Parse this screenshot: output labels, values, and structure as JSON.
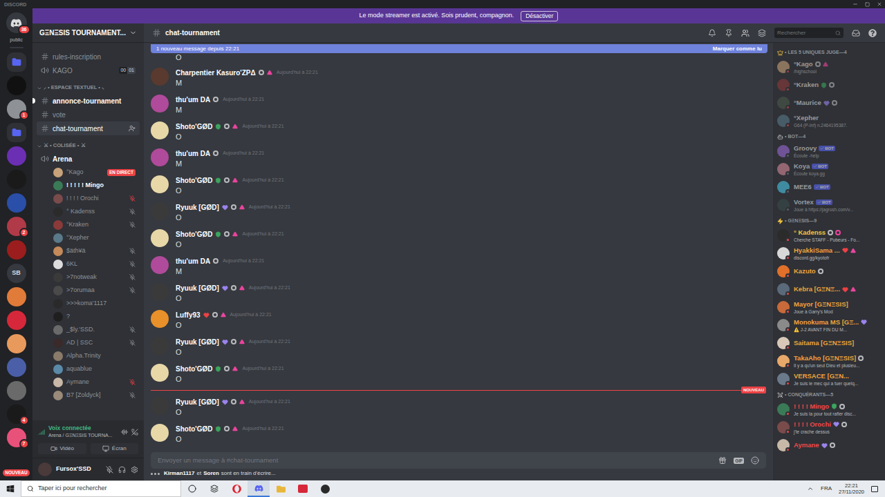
{
  "window": {
    "title": "DISCORD"
  },
  "streamer_banner": {
    "text": "Le mode streamer est activé. Sois prudent, compagnon.",
    "button": "Désactiver"
  },
  "server_rail": {
    "home_badge": "36",
    "home_label": "public",
    "new_label": "NOUVEAU",
    "servers": [
      {
        "kind": "folder",
        "color": "#5865f2"
      },
      {
        "kind": "server",
        "color": "#111111"
      },
      {
        "kind": "server",
        "color": "#8e9297",
        "badge": "1"
      },
      {
        "kind": "folder",
        "color": "#5865f2"
      },
      {
        "kind": "server",
        "color": "#6b2fb3"
      },
      {
        "kind": "server",
        "color": "#1a1a1a"
      },
      {
        "kind": "server",
        "color": "#2a4fa8"
      },
      {
        "kind": "server",
        "color": "#b03a48",
        "badge": "2"
      },
      {
        "kind": "server",
        "color": "#9c1d1d"
      },
      {
        "kind": "text",
        "color": "#36393f",
        "label": "SB"
      },
      {
        "kind": "server",
        "color": "#e07b39"
      },
      {
        "kind": "server",
        "color": "#d6283a"
      },
      {
        "kind": "server",
        "color": "#e89a5c"
      },
      {
        "kind": "server",
        "color": "#4a5fa8"
      },
      {
        "kind": "server",
        "color": "#6a6a6a"
      },
      {
        "kind": "server",
        "color": "#1a1a1a",
        "badge": "4"
      },
      {
        "kind": "server",
        "color": "#e8517a",
        "badge": "7"
      }
    ]
  },
  "server": {
    "name": "GΞNΞSIS TOURNAMENT..."
  },
  "channels": [
    {
      "kind": "text",
      "name": "rules-inscription",
      "unread": false,
      "selected": false
    },
    {
      "kind": "voice",
      "name": "KAGO",
      "connected": false,
      "counts": [
        "00",
        "01"
      ]
    },
    {
      "kind": "category",
      "name": "⸝ • ESPACE TEXTUEL • ⸜"
    },
    {
      "kind": "text",
      "name": "annonce-tournament",
      "unread": true,
      "selected": false
    },
    {
      "kind": "text",
      "name": "vote",
      "unread": false,
      "selected": false
    },
    {
      "kind": "text",
      "name": "chat-tournament",
      "unread": false,
      "selected": true
    },
    {
      "kind": "category",
      "name": "⚔ • COLISÉE • ⚔"
    },
    {
      "kind": "voice",
      "name": "Arena",
      "connected": true,
      "counts": []
    }
  ],
  "voice_users": [
    {
      "name": "°Kago",
      "avatar": "#c8a27a",
      "muted": false,
      "server_muted": false,
      "highlighted": false,
      "live": "EN DIRECT"
    },
    {
      "name": "! ! ! ! ! Mingo",
      "avatar": "#3b7a57",
      "muted": false,
      "server_muted": false,
      "highlighted": true
    },
    {
      "name": "! ! ! ! Orochi",
      "avatar": "#7a4b4b",
      "muted": true,
      "server_muted": true,
      "highlighted": false
    },
    {
      "name": "° Kadenss",
      "avatar": "#2b2b2b",
      "muted": true,
      "server_muted": false,
      "highlighted": false
    },
    {
      "name": "°Kraken",
      "avatar": "#8b3a3a",
      "muted": true,
      "server_muted": false,
      "highlighted": false
    },
    {
      "name": "°Xepher",
      "avatar": "#5a7a8a",
      "muted": false,
      "server_muted": false,
      "highlighted": false
    },
    {
      "name": "$äth¥ä",
      "avatar": "#c48a5a",
      "muted": true,
      "server_muted": false,
      "highlighted": false
    },
    {
      "name": "6KL",
      "avatar": "#dcdcdc",
      "muted": true,
      "server_muted": false,
      "highlighted": false
    },
    {
      "name": ">7notweak",
      "avatar": "#3a3a3a",
      "muted": true,
      "server_muted": false,
      "highlighted": false
    },
    {
      "name": ">7orumaa",
      "avatar": "#4a4a4a",
      "muted": true,
      "server_muted": false,
      "highlighted": false
    },
    {
      "name": ">>>koma'1117",
      "avatar": "#2a2a2a",
      "muted": false,
      "server_muted": false,
      "highlighted": false
    },
    {
      "name": "?",
      "avatar": "#1f1f1f",
      "muted": false,
      "server_muted": false,
      "highlighted": false
    },
    {
      "name": "_$ly.'SSD.",
      "avatar": "#6a6a6a",
      "muted": true,
      "server_muted": false,
      "highlighted": false
    },
    {
      "name": "AD | SSC",
      "avatar": "#3a2a2a",
      "muted": true,
      "server_muted": false,
      "highlighted": false
    },
    {
      "name": "Alpha.Trinity",
      "avatar": "#8a7a6a",
      "muted": false,
      "server_muted": false,
      "highlighted": false
    },
    {
      "name": "aquablue",
      "avatar": "#5a8aa8",
      "muted": false,
      "server_muted": false,
      "highlighted": false
    },
    {
      "name": "Aymane",
      "avatar": "#c8b8a8",
      "muted": true,
      "server_muted": true,
      "highlighted": false
    },
    {
      "name": "B7 [Zoldyck]",
      "avatar": "#9a8a7a",
      "muted": true,
      "server_muted": false,
      "highlighted": false
    }
  ],
  "voice_panel": {
    "title": "Voix connectée",
    "subtitle": "Arena / GΞNΞSIS TOURNA...",
    "buttons": [
      "Vidéo",
      "Écran"
    ]
  },
  "user": {
    "name": "Fursox'SSD",
    "avatar": "#4a3a3a",
    "mic_muted": true
  },
  "header": {
    "channel": "chat-tournament",
    "search_placeholder": "Rechercher"
  },
  "new_messages_bar": {
    "text": "1 nouveau message depuis 22:21",
    "action": "Marquer comme lu"
  },
  "new_divider": {
    "label": "NOUVEAU"
  },
  "messages": [
    {
      "kind": "partial",
      "content": "O"
    },
    {
      "kind": "full",
      "author": "Charpentier Kasuro'ZPΔ",
      "avatar": "#5a3a2e",
      "time": "Aujourd'hui à 22:21",
      "content": "M",
      "divider_before": false,
      "badges": [
        {
          "kind": "dot",
          "color": "#b9bbbe"
        },
        {
          "kind": "triangle",
          "color": "#eb459e"
        }
      ]
    },
    {
      "kind": "full",
      "author": "thu'um DA",
      "avatar": "#b04a9a",
      "time": "Aujourd'hui à 22:21",
      "content": "M",
      "divider_before": false,
      "badges": [
        {
          "kind": "dot",
          "color": "#b9bbbe"
        }
      ]
    },
    {
      "kind": "full",
      "author": "Shoto'GØD",
      "avatar": "#e8d8a8",
      "time": "Aujourd'hui à 22:21",
      "content": "O",
      "divider_before": false,
      "badges": [
        {
          "kind": "shield",
          "color": "#3ba55d"
        },
        {
          "kind": "dot",
          "color": "#b9bbbe"
        },
        {
          "kind": "triangle",
          "color": "#eb459e"
        }
      ]
    },
    {
      "kind": "full",
      "author": "thu'um DA",
      "avatar": "#b04a9a",
      "time": "Aujourd'hui à 22:21",
      "content": "M",
      "divider_before": false,
      "badges": [
        {
          "kind": "dot",
          "color": "#b9bbbe"
        }
      ]
    },
    {
      "kind": "full",
      "author": "Shoto'GØD",
      "avatar": "#e8d8a8",
      "time": "Aujourd'hui à 22:21",
      "content": "O",
      "divider_before": false,
      "badges": [
        {
          "kind": "shield",
          "color": "#3ba55d"
        },
        {
          "kind": "dot",
          "color": "#b9bbbe"
        },
        {
          "kind": "triangle",
          "color": "#eb459e"
        }
      ]
    },
    {
      "kind": "full",
      "author": "Ryuuk [GØD]",
      "avatar": "#3a3a3a",
      "time": "Aujourd'hui à 22:21",
      "content": "O",
      "divider_before": false,
      "badges": [
        {
          "kind": "heart",
          "color": "#9b84ee"
        },
        {
          "kind": "dot",
          "color": "#b9bbbe"
        },
        {
          "kind": "triangle",
          "color": "#eb459e"
        }
      ]
    },
    {
      "kind": "full",
      "author": "Shoto'GØD",
      "avatar": "#e8d8a8",
      "time": "Aujourd'hui à 22:21",
      "content": "O",
      "divider_before": false,
      "badges": [
        {
          "kind": "shield",
          "color": "#3ba55d"
        },
        {
          "kind": "dot",
          "color": "#b9bbbe"
        },
        {
          "kind": "triangle",
          "color": "#eb459e"
        }
      ]
    },
    {
      "kind": "full",
      "author": "thu'um DA",
      "avatar": "#b04a9a",
      "time": "Aujourd'hui à 22:21",
      "content": "M",
      "divider_before": false,
      "badges": [
        {
          "kind": "dot",
          "color": "#b9bbbe"
        }
      ]
    },
    {
      "kind": "full",
      "author": "Ryuuk [GØD]",
      "avatar": "#3a3a3a",
      "time": "Aujourd'hui à 22:21",
      "content": "O",
      "divider_before": false,
      "badges": [
        {
          "kind": "heart",
          "color": "#9b84ee"
        },
        {
          "kind": "dot",
          "color": "#b9bbbe"
        },
        {
          "kind": "triangle",
          "color": "#eb459e"
        }
      ]
    },
    {
      "kind": "full",
      "author": "Luffy93",
      "avatar": "#e8902a",
      "time": "Aujourd'hui à 22:21",
      "content": "O",
      "divider_before": false,
      "badges": [
        {
          "kind": "heart",
          "color": "#ed4245"
        },
        {
          "kind": "dot",
          "color": "#b9bbbe"
        },
        {
          "kind": "triangle",
          "color": "#eb459e"
        }
      ]
    },
    {
      "kind": "full",
      "author": "Ryuuk [GØD]",
      "avatar": "#3a3a3a",
      "time": "Aujourd'hui à 22:21",
      "content": "O",
      "divider_before": false,
      "badges": [
        {
          "kind": "heart",
          "color": "#9b84ee"
        },
        {
          "kind": "dot",
          "color": "#b9bbbe"
        },
        {
          "kind": "triangle",
          "color": "#eb459e"
        }
      ]
    },
    {
      "kind": "full",
      "author": "Shoto'GØD",
      "avatar": "#e8d8a8",
      "time": "Aujourd'hui à 22:21",
      "content": "O",
      "divider_before": false,
      "badges": [
        {
          "kind": "shield",
          "color": "#3ba55d"
        },
        {
          "kind": "dot",
          "color": "#b9bbbe"
        },
        {
          "kind": "triangle",
          "color": "#eb459e"
        }
      ]
    },
    {
      "kind": "full",
      "author": "Ryuuk [GØD]",
      "avatar": "#3a3a3a",
      "time": "Aujourd'hui à 22:21",
      "content": "O",
      "divider_before": true,
      "badges": [
        {
          "kind": "heart",
          "color": "#9b84ee"
        },
        {
          "kind": "dot",
          "color": "#b9bbbe"
        },
        {
          "kind": "triangle",
          "color": "#eb459e"
        }
      ]
    },
    {
      "kind": "full",
      "author": "Shoto'GØD",
      "avatar": "#e8d8a8",
      "time": "Aujourd'hui à 22:21",
      "content": "O",
      "divider_before": false,
      "badges": [
        {
          "kind": "shield",
          "color": "#3ba55d"
        },
        {
          "kind": "dot",
          "color": "#b9bbbe"
        },
        {
          "kind": "triangle",
          "color": "#eb459e"
        }
      ]
    }
  ],
  "composer": {
    "placeholder": "Envoyer un message à #chat-tournament",
    "gif_label": "GIF"
  },
  "typing": {
    "users": [
      "Kirman1117",
      "Soren"
    ],
    "joiner": "et",
    "suffix": "sont en train d'écrire..."
  },
  "member_groups": [
    {
      "kind": "judges",
      "title": "• LES 5 UNIQUES JUGE—4",
      "members": [
        {
          "name": "°Kago",
          "color": "#dcddde",
          "status": "/highschool",
          "avatar": "#c8a27a",
          "presence": "#f04747",
          "dimmed": true,
          "badges": [
            {
              "kind": "dot",
              "color": "#b9bbbe"
            },
            {
              "kind": "triangle",
              "color": "#eb459e"
            }
          ]
        },
        {
          "name": "°Kraken",
          "color": "#dcddde",
          "avatar": "#8b3a3a",
          "presence": "#f04747",
          "dimmed": true,
          "badges": [
            {
              "kind": "shield",
              "color": "#3ba55d"
            },
            {
              "kind": "dot",
              "color": "#b9bbbe"
            }
          ]
        },
        {
          "name": "°Maurice",
          "color": "#dcddde",
          "avatar": "#4a5a4a",
          "presence": "#f04747",
          "dimmed": true,
          "badges": [
            {
              "kind": "heart",
              "color": "#9b84ee"
            },
            {
              "kind": "dot",
              "color": "#b9bbbe"
            }
          ]
        },
        {
          "name": "°Xepher",
          "color": "#dcddde",
          "status": "G64 (P-Inf) n.2464195387.",
          "avatar": "#5a7a8a",
          "presence": "#f04747",
          "dimmed": true,
          "badges": []
        }
      ]
    },
    {
      "kind": "bots",
      "title": "• BOT—4",
      "members": [
        {
          "name": "Groovy",
          "color": "#dcddde",
          "status": "Écoute -help",
          "avatar": "#9b6ad6",
          "presence": "#747f8d",
          "dimmed": true,
          "tag": "BOT",
          "badges": []
        },
        {
          "name": "Koya",
          "color": "#dcddde",
          "status": "Écoute koya.gg",
          "avatar": "#d68a9a",
          "presence": "#747f8d",
          "dimmed": true,
          "tag": "BOT",
          "badges": []
        },
        {
          "name": "MEE6",
          "color": "#dcddde",
          "avatar": "#4ac8e8",
          "presence": "#747f8d",
          "dimmed": true,
          "tag": "BOT",
          "badges": []
        },
        {
          "name": "Vortex",
          "color": "#dcddde",
          "status": "Joue à https://jagrosh.com/v...",
          "avatar": "#3a4a4a",
          "presence": "#747f8d",
          "dimmed": true,
          "tag": "BOT",
          "badges": []
        }
      ]
    },
    {
      "kind": "genesis",
      "title": "• GΞNΞSIS—9",
      "members": [
        {
          "name": "° Kadenss",
          "color": "#f5c542",
          "status": "Cherche STAFF - Pubeurs - Fo...",
          "avatar": "#2b2b2b",
          "presence": "#f04747",
          "dimmed": false,
          "badges": [
            {
              "kind": "dot",
              "color": "#b9bbbe"
            },
            {
              "kind": "dot",
              "color": "#eb459e"
            }
          ]
        },
        {
          "name": "HyakkiSama ...",
          "color": "#f0a23c",
          "status": "discord.gg/kyotofr",
          "avatar": "#d8d8d8",
          "presence": "#f04747",
          "dimmed": false,
          "badges": [
            {
              "kind": "heart",
              "color": "#ed4245"
            },
            {
              "kind": "triangle",
              "color": "#eb459e"
            }
          ]
        },
        {
          "name": "Kazuto",
          "color": "#f0a23c",
          "avatar": "#e0702a",
          "presence": "#f04747",
          "dimmed": false,
          "badges": [
            {
              "kind": "dot",
              "color": "#b9bbbe"
            }
          ]
        },
        {
          "name": "Kebra [GΞNΞ...",
          "color": "#f0a23c",
          "avatar": "#5a6a7a",
          "presence": "#f04747",
          "dimmed": false,
          "badges": [
            {
              "kind": "heart",
              "color": "#ed4245"
            },
            {
              "kind": "triangle",
              "color": "#eb459e"
            }
          ]
        },
        {
          "name": "Mayor [GΞNΞSIS]",
          "color": "#f0a23c",
          "status": "Joue à Garry's Mod",
          "avatar": "#c86a3a",
          "presence": "#f04747",
          "dimmed": false,
          "badges": []
        },
        {
          "name": "Monokuma MS [GΞ...",
          "color": "#f0a23c",
          "status": "⚠️ J-2 AVANT FIN DU M...",
          "avatar": "#8a8a8a",
          "presence": "#f04747",
          "dimmed": false,
          "badges": [
            {
              "kind": "heart",
              "color": "#9b84ee"
            }
          ]
        },
        {
          "name": "Saitama [GΞNΞSIS]",
          "color": "#f0a23c",
          "avatar": "#d8c8b8",
          "presence": "#f04747",
          "dimmed": false,
          "badges": []
        },
        {
          "name": "TakaAho [GΞNΞSIS]",
          "color": "#f0a23c",
          "status": "Il y a qu'un seul Dieu et plusieu...",
          "avatar": "#e8a86a",
          "presence": "#f04747",
          "dimmed": false,
          "badges": [
            {
              "kind": "dot",
              "color": "#b9bbbe"
            }
          ]
        },
        {
          "name": "VERSACE [GΞN...",
          "color": "#f0a23c",
          "status": "Je suis le mec qui a tuer quelq...",
          "avatar": "#6a7a8a",
          "presence": "#f04747",
          "dimmed": false,
          "badges": []
        }
      ]
    },
    {
      "kind": "conquerors",
      "title": "• CONQUÉRANTS—5",
      "members": [
        {
          "name": "! ! ! ! Mingo",
          "color": "#f04747",
          "status": "Je suis la pour tout rafler disc...",
          "avatar": "#3b7a57",
          "presence": "#f04747",
          "dimmed": false,
          "badges": [
            {
              "kind": "shield",
              "color": "#3ba55d"
            },
            {
              "kind": "dot",
              "color": "#b9bbbe"
            }
          ]
        },
        {
          "name": "! ! ! ! Orochi",
          "color": "#f04747",
          "status": "j'te crache dessus",
          "avatar": "#7a4b4b",
          "presence": "#f04747",
          "dimmed": false,
          "badges": [
            {
              "kind": "heart",
              "color": "#9b84ee"
            },
            {
              "kind": "dot",
              "color": "#b9bbbe"
            }
          ]
        },
        {
          "name": "Aymane",
          "color": "#f04747",
          "avatar": "#c8b8a8",
          "presence": "#f04747",
          "dimmed": false,
          "badges": [
            {
              "kind": "heart",
              "color": "#9b84ee"
            },
            {
              "kind": "dot",
              "color": "#b9bbbe"
            }
          ]
        }
      ]
    }
  ],
  "taskbar": {
    "search_placeholder": "Taper ici pour rechercher",
    "language": "FRA",
    "time": "22:21",
    "date": "27/11/2020"
  }
}
